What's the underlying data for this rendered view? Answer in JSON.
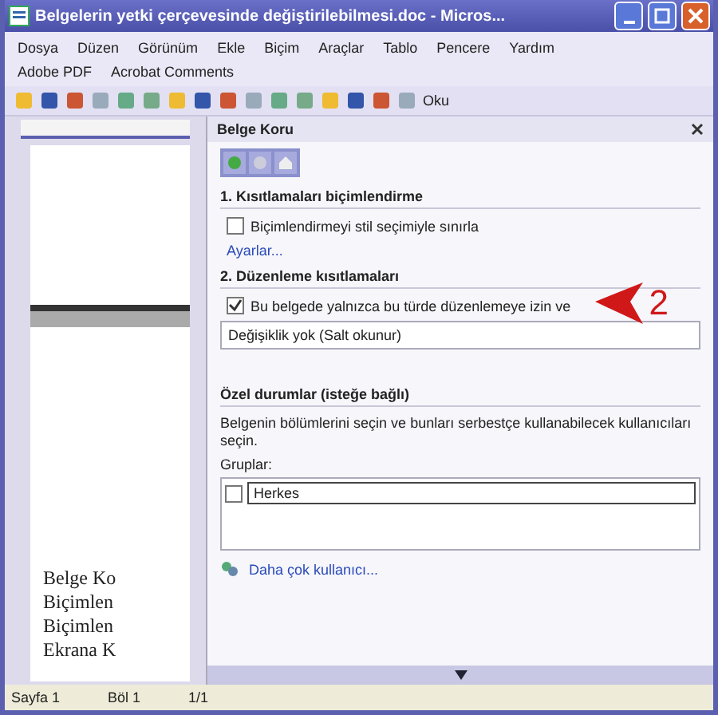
{
  "window": {
    "title": "Belgelerin yetki çerçevesinde değiştirilebilmesi.doc - Micros..."
  },
  "menu": {
    "rows": [
      [
        "Dosya",
        "Düzen",
        "Görünüm",
        "Ekle",
        "Biçim",
        "Araçlar",
        "Tablo",
        "Pencere",
        "Yardım"
      ],
      [
        "Adobe PDF",
        "Acrobat Comments"
      ]
    ]
  },
  "toolbar": {
    "read_label": "Oku"
  },
  "document": {
    "lines": [
      "Belge Ko",
      "Biçimlen",
      "Biçimlen",
      "Ekrana K"
    ]
  },
  "task_pane": {
    "title": "Belge Koru",
    "section_1": {
      "heading": "1. Kısıtlamaları biçimlendirme",
      "checkbox": {
        "label": "Biçimlendirmeyi stil seçimiyle sınırla",
        "checked": false
      },
      "link": "Ayarlar..."
    },
    "section_2": {
      "heading": "2. Düzenleme kısıtlamaları",
      "checkbox": {
        "label": "Bu belgede yalnızca bu türde düzenlemeye izin ve",
        "checked": true
      },
      "dropdown": "Değişiklik yok (Salt okunur)"
    },
    "exceptions": {
      "heading": "Özel durumlar (isteğe bağlı)",
      "description": "Belgenin bölümlerini seçin ve bunları serbestçe kullanabilecek kullanıcıları seçin.",
      "groups_label": "Gruplar:",
      "groups": [
        {
          "name": "Herkes",
          "checked": false
        }
      ],
      "link": "Daha çok kullanıcı..."
    }
  },
  "annotation": {
    "number": "2"
  },
  "status_bar": [
    "Sayfa 1",
    "Böl 1",
    "1/1"
  ]
}
